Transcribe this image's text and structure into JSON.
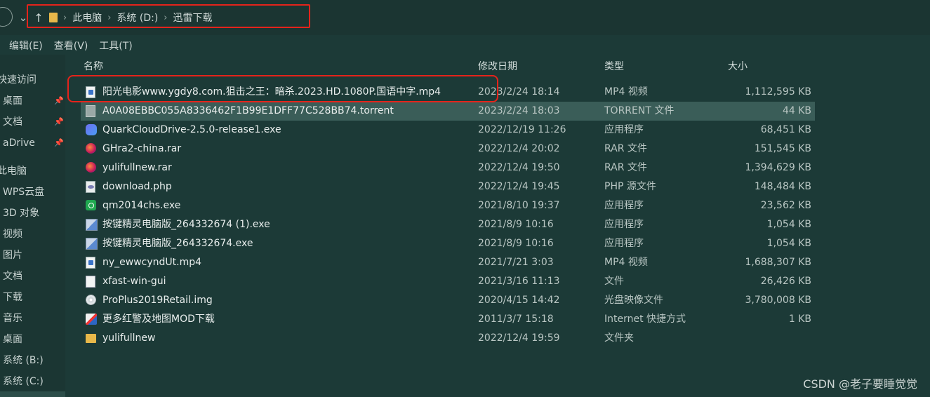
{
  "address": {
    "breadcrumbs": [
      "此电脑",
      "系统 (D:)",
      "迅雷下载"
    ]
  },
  "menu": [
    "编辑(E)",
    "查看(V)",
    "工具(T)"
  ],
  "sidebar": {
    "items": [
      {
        "label": "快速访问",
        "pinned": false
      },
      {
        "label": "桌面",
        "pinned": true
      },
      {
        "label": "文档",
        "pinned": true
      },
      {
        "label": "aDrive",
        "pinned": true
      },
      {
        "label": "此电脑",
        "pinned": false
      },
      {
        "label": "WPS云盘",
        "pinned": false
      },
      {
        "label": "3D 对象",
        "pinned": false
      },
      {
        "label": "视频",
        "pinned": false
      },
      {
        "label": "图片",
        "pinned": false
      },
      {
        "label": "文档",
        "pinned": false
      },
      {
        "label": "下载",
        "pinned": false
      },
      {
        "label": "音乐",
        "pinned": false
      },
      {
        "label": "桌面",
        "pinned": false
      },
      {
        "label": "系统 (B:)",
        "pinned": false
      },
      {
        "label": "系统 (C:)",
        "pinned": false
      }
    ]
  },
  "columns": {
    "name": "名称",
    "date": "修改日期",
    "type": "类型",
    "size": "大小"
  },
  "files": [
    {
      "icon": "video-file-icon",
      "name": "阳光电影www.ygdy8.com.狙击之王：暗杀.2023.HD.1080P.国语中字.mp4",
      "date": "2023/2/24 18:14",
      "type": "MP4 视频",
      "size": "1,112,595 KB",
      "selected": false
    },
    {
      "icon": "torrent-file-icon",
      "name": "A0A08EBBC055A8336462F1B99E1DFF77C528BB74.torrent",
      "date": "2023/2/24 18:03",
      "type": "TORRENT 文件",
      "size": "44 KB",
      "selected": true
    },
    {
      "icon": "quark-app-icon",
      "name": "QuarkCloudDrive-2.5.0-release1.exe",
      "date": "2022/12/19 11:26",
      "type": "应用程序",
      "size": "68,451 KB",
      "selected": false
    },
    {
      "icon": "rar-archive-icon",
      "name": "GHra2-china.rar",
      "date": "2022/12/4 20:02",
      "type": "RAR 文件",
      "size": "151,545 KB",
      "selected": false
    },
    {
      "icon": "rar-archive-icon",
      "name": "yulifullnew.rar",
      "date": "2022/12/4 19:50",
      "type": "RAR 文件",
      "size": "1,394,629 KB",
      "selected": false
    },
    {
      "icon": "php-file-icon",
      "name": "download.php",
      "date": "2022/12/4 19:45",
      "type": "PHP 源文件",
      "size": "148,484 KB",
      "selected": false
    },
    {
      "icon": "qm-app-icon",
      "name": "qm2014chs.exe",
      "date": "2021/8/10 19:37",
      "type": "应用程序",
      "size": "23,562 KB",
      "selected": false
    },
    {
      "icon": "installer-icon",
      "name": "按键精灵电脑版_264332674 (1).exe",
      "date": "2021/8/9 10:16",
      "type": "应用程序",
      "size": "1,054 KB",
      "selected": false
    },
    {
      "icon": "installer-icon",
      "name": "按键精灵电脑版_264332674.exe",
      "date": "2021/8/9 10:16",
      "type": "应用程序",
      "size": "1,054 KB",
      "selected": false
    },
    {
      "icon": "video-file-icon",
      "name": "ny_ewwcyndUt.mp4",
      "date": "2021/7/21 3:03",
      "type": "MP4 视频",
      "size": "1,688,307 KB",
      "selected": false
    },
    {
      "icon": "blank-file-icon",
      "name": "xfast-win-gui",
      "date": "2021/3/16 11:13",
      "type": "文件",
      "size": "26,426 KB",
      "selected": false
    },
    {
      "icon": "disc-image-icon",
      "name": "ProPlus2019Retail.img",
      "date": "2020/4/15 14:42",
      "type": "光盘映像文件",
      "size": "3,780,008 KB",
      "selected": false
    },
    {
      "icon": "internet-shortcut-icon",
      "name": "更多红警及地图MOD下载",
      "date": "2011/3/7 15:18",
      "type": "Internet 快捷方式",
      "size": "1 KB",
      "selected": false
    },
    {
      "icon": "folder-icon",
      "name": "yulifullnew",
      "date": "2022/12/4 19:59",
      "type": "文件夹",
      "size": "",
      "selected": false
    }
  ],
  "watermark": "CSDN @老子要睡觉觉",
  "colors": {
    "background": "#1c3a37",
    "selected_row": "#3a5d58",
    "annotation_red": "#e5231b"
  }
}
